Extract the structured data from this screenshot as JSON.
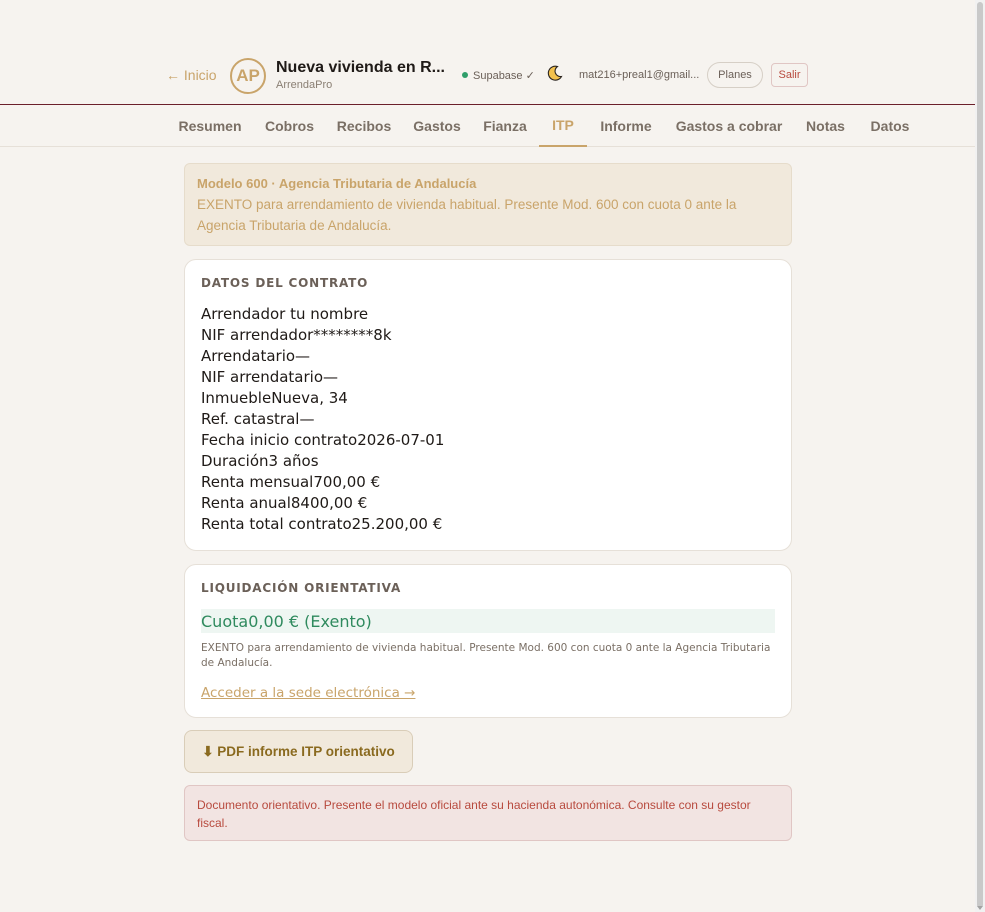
{
  "header": {
    "back_label": "← Inicio",
    "avatar_initials": "AP",
    "title": "Nueva vivienda en R...",
    "subtitle": "ArrendaPro",
    "sync_status": "Supabase ✓",
    "user_email": "mat216+preal1@gmail...",
    "plans_label": "Planes",
    "logout_label": "Salir"
  },
  "tabs": [
    {
      "label": "Resumen",
      "active": false
    },
    {
      "label": "Cobros",
      "active": false
    },
    {
      "label": "Recibos",
      "active": false
    },
    {
      "label": "Gastos",
      "active": false
    },
    {
      "label": "Fianza",
      "active": false
    },
    {
      "label": "ITP",
      "active": true
    },
    {
      "label": "Informe",
      "active": false
    },
    {
      "label": "Gastos a cobrar",
      "active": false
    },
    {
      "label": "Notas",
      "active": false
    },
    {
      "label": "Datos",
      "active": false
    }
  ],
  "banner": {
    "title": "Modelo 600 · Agencia Tributaria de Andalucía",
    "text": "EXENTO para arrendamiento de vivienda habitual. Presente Mod. 600 con cuota 0 ante la Agencia Tributaria de Andalucía."
  },
  "contract": {
    "title": "DATOS DEL CONTRATO",
    "rows": [
      {
        "label": "Arrendador",
        "value": " tu nombre"
      },
      {
        "label": "NIF arrendador",
        "value": "********8k"
      },
      {
        "label": "Arrendatario",
        "value": "—"
      },
      {
        "label": "NIF arrendatario",
        "value": "—"
      },
      {
        "label": "Inmueble",
        "value": "Nueva, 34"
      },
      {
        "label": "Ref. catastral",
        "value": "—"
      },
      {
        "label": "Fecha inicio contrato",
        "value": "2026-07-01"
      },
      {
        "label": "Duración",
        "value": "3 años"
      },
      {
        "label": "Renta mensual",
        "value": "700,00 €"
      },
      {
        "label": "Renta anual",
        "value": "8400,00 €"
      },
      {
        "label": "Renta total contrato",
        "value": "25.200,00 €"
      }
    ]
  },
  "liquidation": {
    "title": "LIQUIDACIÓN ORIENTATIVA",
    "quota_label": "Cuota",
    "quota_value": "0,00 € (Exento)",
    "note": "EXENTO para arrendamiento de vivienda habitual. Presente Mod. 600 con cuota 0 ante la Agencia Tributaria de Andalucía.",
    "link_label": "Acceder a la sede electrónica →"
  },
  "pdf_button_label": "⬇ PDF informe ITP orientativo",
  "disclaimer": "Documento orientativo. Presente el modelo oficial ante su hacienda autonómica. Consulte con su gestor fiscal.",
  "colors": {
    "accent": "#c9a46a",
    "header_rule": "#6b1f2a",
    "success": "#2f8a5e",
    "danger": "#b84a3e"
  }
}
